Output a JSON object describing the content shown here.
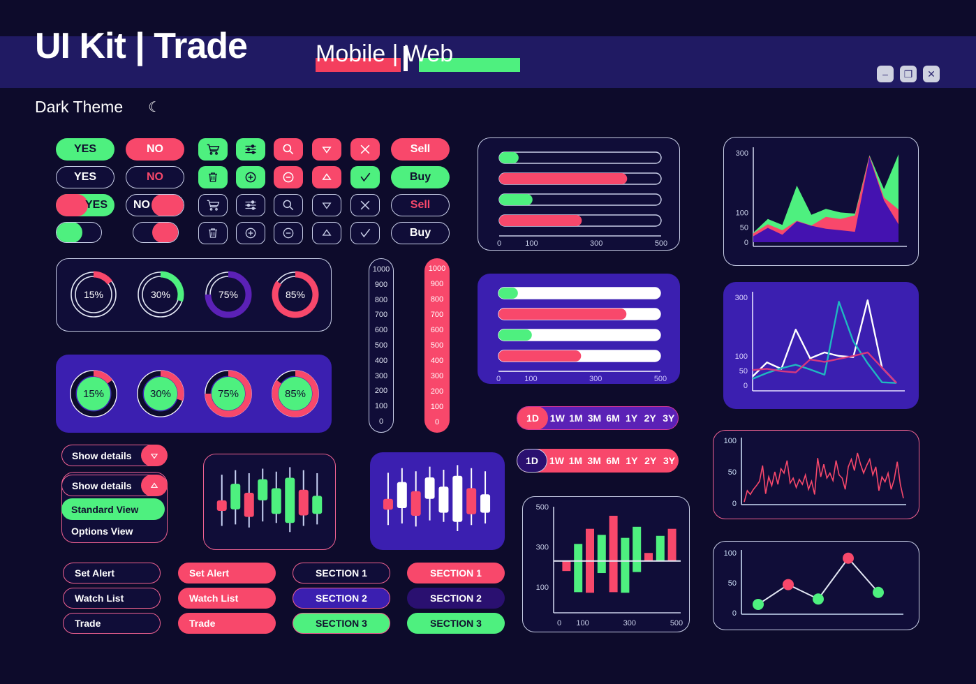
{
  "header": {
    "title": "UI Kit | Trade",
    "subtitle_left": "Mobile",
    "subtitle_sep": "|",
    "subtitle_right": "Web",
    "theme_label": "Dark Theme",
    "moon_icon": "moon-icon",
    "window_controls": [
      {
        "name": "minimize-button",
        "glyph": "–"
      },
      {
        "name": "restore-button",
        "glyph": "❐"
      },
      {
        "name": "close-button",
        "glyph": "✕"
      }
    ]
  },
  "buttons": {
    "yes": "YES",
    "no": "NO",
    "sell": "Sell",
    "buy": "Buy",
    "icons": [
      "cart-icon",
      "sliders-icon",
      "search-icon",
      "triangle-down-icon",
      "close-icon",
      "trash-icon",
      "plus-circle-icon",
      "minus-circle-icon",
      "triangle-up-icon",
      "check-icon"
    ]
  },
  "donuts": {
    "row_outline": [
      {
        "label": "15%",
        "value": 15,
        "color": "#f8486b"
      },
      {
        "label": "30%",
        "value": 30,
        "color": "#4ef07f"
      },
      {
        "label": "75%",
        "value": 75,
        "color": "#5b21b6"
      },
      {
        "label": "85%",
        "value": 85,
        "color": "#f8486b"
      }
    ],
    "row_filled": [
      {
        "label": "15%",
        "value": 15,
        "color": "#f8486b"
      },
      {
        "label": "30%",
        "value": 30,
        "color": "#f8486b"
      },
      {
        "label": "75%",
        "value": 75,
        "color": "#f8486b"
      },
      {
        "label": "85%",
        "value": 85,
        "color": "#f8486b"
      }
    ]
  },
  "scales": {
    "ticks": [
      "1000",
      "900",
      "800",
      "700",
      "600",
      "500",
      "400",
      "300",
      "200",
      "100",
      "0"
    ]
  },
  "sliders_dark": {
    "axis_ticks": [
      "0",
      "100",
      "300",
      "500"
    ],
    "bars": [
      {
        "value": 60,
        "color": "#4ef07f"
      },
      {
        "value": 395,
        "color": "#f8486b"
      },
      {
        "value": 103,
        "color": "#4ef07f"
      },
      {
        "value": 255,
        "color": "#f8486b"
      }
    ],
    "max": 500
  },
  "sliders_purple": {
    "axis_ticks": [
      "0",
      "100",
      "300",
      "500"
    ],
    "bars": [
      {
        "value": 60,
        "color": "#4ef07f"
      },
      {
        "value": 395,
        "color": "#f8486b"
      },
      {
        "value": 103,
        "color": "#4ef07f"
      },
      {
        "value": 255,
        "color": "#f8486b"
      }
    ],
    "max": 500
  },
  "ranges": {
    "options": [
      "1D",
      "1W",
      "1M",
      "3M",
      "6M",
      "1Y",
      "2Y",
      "3Y"
    ],
    "selected": "1D"
  },
  "dropdown": {
    "show_details": "Show details",
    "chevron_down": "chevron-down-icon",
    "chevron_up": "chevron-up-icon",
    "items": [
      {
        "label": "Standard View",
        "active": true
      },
      {
        "label": "Options View",
        "active": false
      }
    ]
  },
  "action_buttons": {
    "col1": [
      "Set Alert",
      "Watch List",
      "Trade"
    ],
    "col2": [
      "Set Alert",
      "Watch List",
      "Trade"
    ],
    "col3": [
      "SECTION 1",
      "SECTION 2",
      "SECTION 3"
    ],
    "col4": [
      "SECTION 1",
      "SECTION 2",
      "SECTION 3"
    ]
  },
  "colors": {
    "background": "#0d0b2b",
    "panel_dark": "#100d38",
    "panel_purple": "#3b1fb0",
    "accent_green": "#4ef07f",
    "accent_red": "#f8486b",
    "accent_violet": "#5b21b6",
    "header_bar": "#201a63",
    "stroke_light": "#c9cfe8"
  },
  "chart_data": [
    {
      "type": "area",
      "name": "stacked-area-chart",
      "title": "",
      "ytick_labels": [
        "0",
        "50",
        "100",
        "300"
      ],
      "ylim": [
        0,
        300
      ],
      "grid": false,
      "series": [
        {
          "name": "violet",
          "color": "#4412b0",
          "values": [
            20,
            48,
            25,
            70,
            55,
            45,
            40,
            35,
            285,
            140,
            60
          ]
        },
        {
          "name": "red",
          "color": "#f8486b",
          "values": [
            30,
            60,
            40,
            72,
            56,
            85,
            78,
            90,
            290,
            150,
            110
          ]
        },
        {
          "name": "green",
          "color": "#4ef07f",
          "values": [
            32,
            78,
            58,
            190,
            92,
            112,
            100,
            96,
            292,
            178,
            295
          ]
        }
      ]
    },
    {
      "type": "line",
      "name": "multi-line-chart",
      "ytick_labels": [
        "0",
        "50",
        "100",
        "300"
      ],
      "ylim": [
        0,
        300
      ],
      "grid": false,
      "series": [
        {
          "name": "white",
          "color": "#ffffff",
          "values": [
            30,
            78,
            56,
            190,
            92,
            112,
            100,
            96,
            290,
            60,
            8
          ]
        },
        {
          "name": "teal",
          "color": "#1fb8c0",
          "values": [
            22,
            42,
            58,
            70,
            54,
            36,
            285,
            150,
            75,
            10,
            8
          ]
        },
        {
          "name": "pink",
          "color": "#d6387f",
          "values": [
            52,
            56,
            48,
            44,
            88,
            80,
            90,
            100,
            112,
            60,
            8
          ]
        }
      ]
    },
    {
      "type": "line",
      "name": "volatility-line-chart",
      "ytick_labels": [
        "0",
        "50",
        "100"
      ],
      "ylim": [
        0,
        100
      ],
      "grid": false,
      "series": [
        {
          "name": "ticks",
          "color": "#f8486b",
          "values": [
            2,
            20,
            14,
            22,
            28,
            35,
            60,
            15,
            42,
            28,
            50,
            30,
            55,
            48,
            68,
            32,
            40,
            25,
            38,
            30,
            45,
            22,
            35,
            14,
            72,
            42,
            62,
            40,
            48,
            36,
            68,
            45,
            40,
            22,
            58,
            70,
            52,
            80,
            62,
            48,
            60,
            70,
            45,
            58,
            20,
            42,
            34,
            48,
            22,
            38,
            66,
            30,
            8
          ]
        }
      ]
    },
    {
      "type": "scatter",
      "name": "marker-line-chart",
      "ytick_labels": [
        "0",
        "50",
        "100"
      ],
      "ylim": [
        0,
        100
      ],
      "grid": false,
      "points": [
        {
          "x": 1,
          "y": 14,
          "color": "#4ef07f"
        },
        {
          "x": 2,
          "y": 47,
          "color": "#f8486b"
        },
        {
          "x": 3,
          "y": 23,
          "color": "#4ef07f"
        },
        {
          "x": 4,
          "y": 91,
          "color": "#f8486b"
        },
        {
          "x": 5,
          "y": 34,
          "color": "#4ef07f"
        }
      ]
    },
    {
      "type": "bar",
      "name": "diverging-bar-chart",
      "ytick_labels": [
        "100",
        "300",
        "500"
      ],
      "xtick_labels": [
        "0",
        "100",
        "300",
        "500"
      ],
      "ylim": [
        0,
        500
      ],
      "baseline": 230,
      "grid": false,
      "bars": [
        {
          "top": 230,
          "bottom": 180,
          "color": "#f8486b"
        },
        {
          "top": 315,
          "bottom": 75,
          "color": "#4ef07f"
        },
        {
          "top": 390,
          "bottom": 72,
          "color": "#f8486b"
        },
        {
          "top": 360,
          "bottom": 170,
          "color": "#4ef07f"
        },
        {
          "top": 455,
          "bottom": 75,
          "color": "#f8486b"
        },
        {
          "top": 345,
          "bottom": 72,
          "color": "#4ef07f"
        },
        {
          "top": 400,
          "bottom": 175,
          "color": "#4ef07f"
        },
        {
          "top": 270,
          "bottom": 230,
          "color": "#f8486b"
        },
        {
          "top": 355,
          "bottom": 230,
          "color": "#4ef07f"
        },
        {
          "top": 390,
          "bottom": 230,
          "color": "#f8486b"
        }
      ]
    },
    {
      "type": "candlestick",
      "name": "candlestick-chart-dark",
      "candles": [
        {
          "high": 86,
          "low": 18,
          "open": 38,
          "close": 52,
          "dir": "down"
        },
        {
          "high": 92,
          "low": 20,
          "open": 74,
          "close": 40,
          "dir": "up"
        },
        {
          "high": 88,
          "low": 16,
          "open": 62,
          "close": 30,
          "dir": "down"
        },
        {
          "high": 94,
          "low": 24,
          "open": 80,
          "close": 52,
          "dir": "up"
        },
        {
          "high": 90,
          "low": 22,
          "open": 68,
          "close": 34,
          "dir": "up"
        },
        {
          "high": 96,
          "low": 10,
          "open": 82,
          "close": 22,
          "dir": "up"
        },
        {
          "high": 92,
          "low": 18,
          "open": 66,
          "close": 32,
          "dir": "down"
        },
        {
          "high": 88,
          "low": 20,
          "open": 58,
          "close": 34,
          "dir": "up"
        }
      ]
    },
    {
      "type": "candlestick",
      "name": "candlestick-chart-purple",
      "candles": [
        {
          "high": 86,
          "low": 18,
          "open": 38,
          "close": 52,
          "dir": "down"
        },
        {
          "high": 92,
          "low": 20,
          "open": 74,
          "close": 40,
          "dir": "white"
        },
        {
          "high": 88,
          "low": 16,
          "open": 62,
          "close": 30,
          "dir": "down"
        },
        {
          "high": 94,
          "low": 24,
          "open": 80,
          "close": 52,
          "dir": "white"
        },
        {
          "high": 90,
          "low": 22,
          "open": 68,
          "close": 34,
          "dir": "white"
        },
        {
          "high": 96,
          "low": 10,
          "open": 82,
          "close": 22,
          "dir": "white"
        },
        {
          "high": 92,
          "low": 18,
          "open": 66,
          "close": 32,
          "dir": "down"
        },
        {
          "high": 88,
          "low": 20,
          "open": 58,
          "close": 34,
          "dir": "white"
        }
      ]
    }
  ]
}
